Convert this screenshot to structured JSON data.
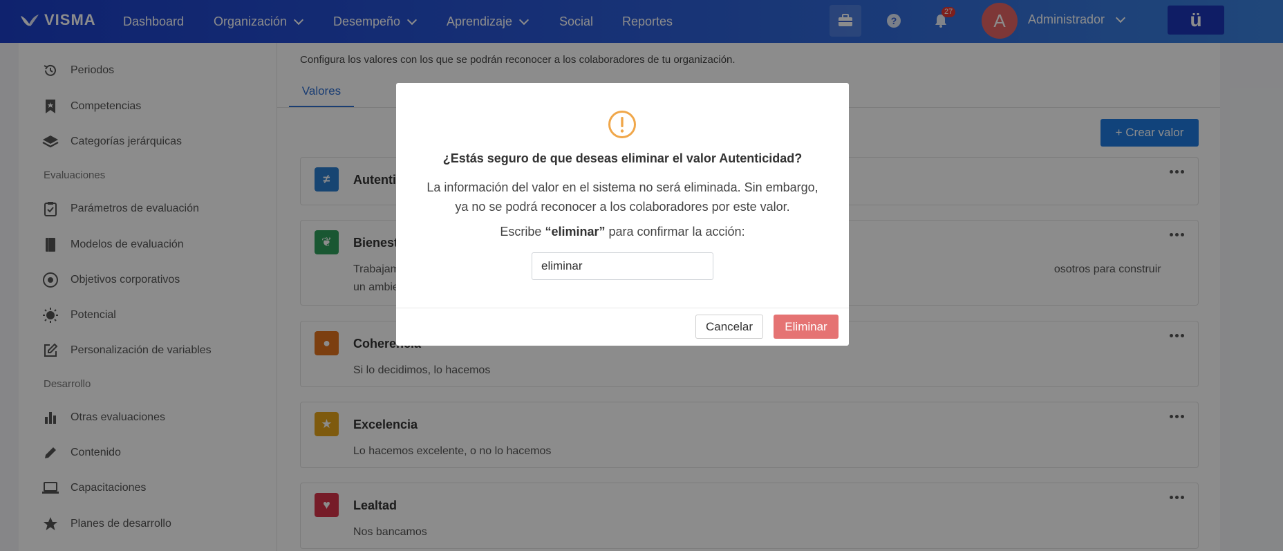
{
  "topbar": {
    "brand": "VISMA",
    "nav": [
      {
        "label": "Dashboard"
      },
      {
        "label": "Organización"
      },
      {
        "label": "Desempeño"
      },
      {
        "label": "Aprendizaje"
      },
      {
        "label": "Social"
      },
      {
        "label": "Reportes"
      }
    ],
    "notifications_count": "27",
    "avatar_initial": "A",
    "user_name": "Administrador",
    "app_button": "ü"
  },
  "sidebar": {
    "items_top": [
      {
        "label": "Periodos",
        "icon": "history-icon"
      },
      {
        "label": "Competencias",
        "icon": "bookmark-icon"
      },
      {
        "label": "Categorías jerárquicas",
        "icon": "layers-icon"
      }
    ],
    "section_evaluaciones": "Evaluaciones",
    "items_eval": [
      {
        "label": "Parámetros de evaluación",
        "icon": "clipboard-check-icon"
      },
      {
        "label": "Modelos de evaluación",
        "icon": "book-icon"
      },
      {
        "label": "Objetivos corporativos",
        "icon": "target-icon"
      },
      {
        "label": "Potencial",
        "icon": "sun-icon"
      },
      {
        "label": "Personalización de variables",
        "icon": "edit-square-icon"
      }
    ],
    "section_desarrollo": "Desarrollo",
    "items_dev": [
      {
        "label": "Otras evaluaciones",
        "icon": "bar-chart-icon"
      },
      {
        "label": "Contenido",
        "icon": "pencil-icon"
      },
      {
        "label": "Capacitaciones",
        "icon": "laptop-icon"
      },
      {
        "label": "Planes de desarrollo",
        "icon": "star-icon"
      }
    ]
  },
  "main": {
    "description": "Configura los valores con los que se podrán reconocer a los colaboradores de tu organización.",
    "tab": "Valores",
    "create_button": "+ Crear valor",
    "values": [
      {
        "name": "Autentici",
        "desc": "",
        "color": "#2b7fd0",
        "symbol": "≠"
      },
      {
        "name": "Bienesta",
        "desc": "Trabajam                                                                                                                                                                                                                     osotros para construir un ambiente donde trabajar sea lo mejor.",
        "color": "#2e9e5b",
        "symbol": "❦"
      },
      {
        "name": "Coherencia",
        "desc": "Si lo decidimos, lo hacemos",
        "color": "#e2731e",
        "symbol": "●"
      },
      {
        "name": "Excelencia",
        "desc": "Lo hacemos excelente, o no lo hacemos",
        "color": "#e6a51a",
        "symbol": "★"
      },
      {
        "name": "Lealtad",
        "desc": "Nos bancamos",
        "color": "#d8344a",
        "symbol": "♥"
      }
    ]
  },
  "modal": {
    "title": "¿Estás seguro de que deseas eliminar el valor Autenticidad?",
    "body": "La información del valor en el sistema no será eliminada. Sin embargo, ya no se podrá reconocer a los colaboradores por este valor.",
    "instruction_prefix": "Escribe ",
    "instruction_keyword": "“eliminar”",
    "instruction_suffix": " para confirmar la acción:",
    "input_value": "eliminar",
    "cancel_label": "Cancelar",
    "delete_label": "Eliminar",
    "warning_color": "#f0a74a",
    "delete_color": "#e57373"
  }
}
